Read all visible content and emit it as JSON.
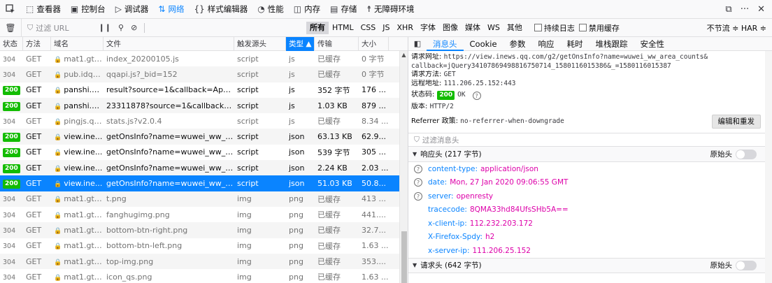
{
  "toolbar": {
    "tabs": [
      {
        "icon": "inspector-icon",
        "glyph": "⬚",
        "label": "查看器"
      },
      {
        "icon": "console-icon",
        "glyph": "▣",
        "label": "控制台"
      },
      {
        "icon": "debugger-icon",
        "glyph": "▷",
        "label": "调试器"
      },
      {
        "icon": "network-icon",
        "glyph": "⇅",
        "label": "网络"
      },
      {
        "icon": "style-editor-icon",
        "glyph": "{}",
        "label": "样式编辑器"
      },
      {
        "icon": "performance-icon",
        "glyph": "◔",
        "label": "性能"
      },
      {
        "icon": "memory-icon",
        "glyph": "◫",
        "label": "内存"
      },
      {
        "icon": "storage-icon",
        "glyph": "▤",
        "label": "存储"
      },
      {
        "icon": "accessibility-icon",
        "glyph": "☨",
        "label": "无障碍环境"
      }
    ],
    "active_tab": "网络"
  },
  "filterbar": {
    "placeholder": "过滤 URL",
    "types": [
      "所有",
      "HTML",
      "CSS",
      "JS",
      "XHR",
      "字体",
      "图像",
      "媒体",
      "WS",
      "其他"
    ],
    "selected_type": "所有",
    "persist_label": "持续日志",
    "disable_cache_label": "禁用缓存",
    "throttle_label": "不节流 ≑ HAR ≑"
  },
  "table": {
    "columns": [
      "状态",
      "方法",
      "域名",
      "文件",
      "触发源头",
      "类型 ▲",
      "传输",
      "大小"
    ],
    "rows": [
      {
        "status": "304",
        "method": "GET",
        "domain": "mat1.gti...",
        "file": "index_20200105.js",
        "cause": "script",
        "type": "js",
        "transferred": "已缓存",
        "size": "0 字节"
      },
      {
        "status": "304",
        "method": "GET",
        "domain": "pub.idqq...",
        "file": "qqapi.js?_bid=152",
        "cause": "script",
        "type": "js",
        "transferred": "已缓存",
        "size": "0 字节"
      },
      {
        "status": "200",
        "method": "GET",
        "domain": "panshi.q...",
        "file": "result?source=1&callback=AppPlat...",
        "cause": "script",
        "type": "js",
        "transferred": "352 字节",
        "size": "176 ..."
      },
      {
        "status": "200",
        "method": "GET",
        "domain": "panshi.q...",
        "file": "23311878?source=1&callback=jQu...",
        "cause": "script",
        "type": "js",
        "transferred": "1.03 KB",
        "size": "879 ..."
      },
      {
        "status": "304",
        "method": "GET",
        "domain": "pingjs.qq...",
        "file": "stats.js?v2.0.4",
        "cause": "script",
        "type": "js",
        "transferred": "已缓存",
        "size": "8.34 ..."
      },
      {
        "status": "200",
        "method": "GET",
        "domain": "view.ine...",
        "file": "getOnsInfo?name=wuwei_ww_time...",
        "cause": "script",
        "type": "json",
        "transferred": "63.13 KB",
        "size": "62.9..."
      },
      {
        "status": "200",
        "method": "GET",
        "domain": "view.ine...",
        "file": "getOnsInfo?name=wuwei_ww_glo...",
        "cause": "script",
        "type": "json",
        "transferred": "539 字节",
        "size": "305 ..."
      },
      {
        "status": "200",
        "method": "GET",
        "domain": "view.ine...",
        "file": "getOnsInfo?name=wuwei_ww_cn_...",
        "cause": "script",
        "type": "json",
        "transferred": "2.24 KB",
        "size": "2.03 ..."
      },
      {
        "status": "200",
        "method": "GET",
        "domain": "view.ine...",
        "file": "getOnsInfo?name=wuwei_ww_area...",
        "cause": "script",
        "type": "json",
        "transferred": "51.03 KB",
        "size": "50.8...",
        "selected": true
      },
      {
        "status": "304",
        "method": "GET",
        "domain": "mat1.gti...",
        "file": "t.png",
        "cause": "img",
        "type": "png",
        "transferred": "已缓存",
        "size": "413 ..."
      },
      {
        "status": "304",
        "method": "GET",
        "domain": "mat1.gti...",
        "file": "fanghugimg.png",
        "cause": "img",
        "type": "png",
        "transferred": "已缓存",
        "size": "441...."
      },
      {
        "status": "304",
        "method": "GET",
        "domain": "mat1.gti...",
        "file": "bottom-btn-right.png",
        "cause": "img",
        "type": "png",
        "transferred": "已缓存",
        "size": "32.7..."
      },
      {
        "status": "304",
        "method": "GET",
        "domain": "mat1.gti...",
        "file": "bottom-btn-left.png",
        "cause": "img",
        "type": "png",
        "transferred": "已缓存",
        "size": "1.63 ..."
      },
      {
        "status": "304",
        "method": "GET",
        "domain": "mat1.gti...",
        "file": "top-img.png",
        "cause": "img",
        "type": "png",
        "transferred": "已缓存",
        "size": "353...."
      },
      {
        "status": "304",
        "method": "GET",
        "domain": "mat1.gti...",
        "file": "icon_qs.png",
        "cause": "img",
        "type": "png",
        "transferred": "已缓存",
        "size": "1.63 ..."
      }
    ]
  },
  "details": {
    "tabs": [
      "消息头",
      "Cookie",
      "参数",
      "响应",
      "耗时",
      "堆栈跟踪",
      "安全性"
    ],
    "active_tab": "消息头",
    "request_url_label": "请求网址:",
    "request_url_1": "https://view.inews.qq.com/g2/getOnsInfo?name=wuwei_ww_area_counts&",
    "request_url_2": "callback=jQuery34107869498816750714_1580116015386&_=1580116015387",
    "method_label": "请求方法:",
    "method": "GET",
    "remote_label": "远程地址:",
    "remote": "111.206.25.152:443",
    "status_label": "状态码:",
    "status_code": "200",
    "status_text": "OK",
    "version_label": "版本:",
    "version": "HTTP/2",
    "referrer_label": "Referrer 政策:",
    "referrer": "no-referrer-when-downgrade",
    "resend_label": "编辑和重发",
    "filter_placeholder": "过滤消息头",
    "response_section": "响应头 (217 字节)",
    "raw_label": "原始头",
    "response_headers": [
      {
        "name": "content-type:",
        "value": "application/json",
        "help": true
      },
      {
        "name": "date:",
        "value": "Mon, 27 Jan 2020 09:06:55 GMT",
        "help": true
      },
      {
        "name": "server:",
        "value": "openresty",
        "help": true
      },
      {
        "name": "tracecode:",
        "value": "8QMA33hd84UfsSHb5A==",
        "help": false
      },
      {
        "name": "x-client-ip:",
        "value": "112.232.203.172",
        "help": false
      },
      {
        "name": "X-Firefox-Spdy:",
        "value": "h2",
        "help": false
      },
      {
        "name": "x-server-ip:",
        "value": "111.206.25.152",
        "help": false
      }
    ],
    "request_section": "请求头 (642 字节)"
  }
}
